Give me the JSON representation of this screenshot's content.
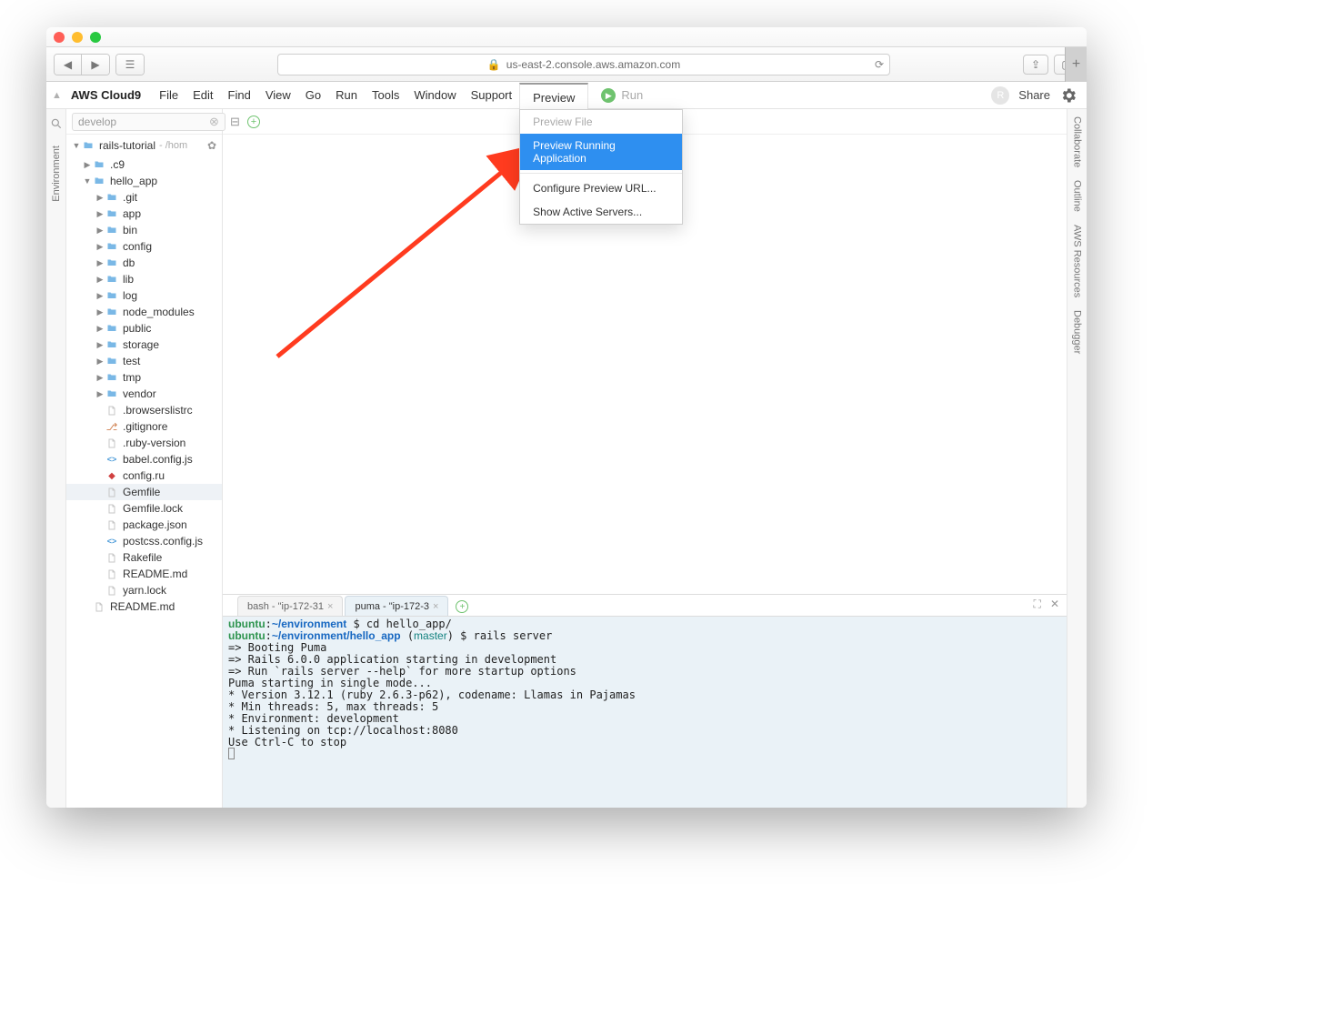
{
  "browser": {
    "url_host": "us-east-2.console.aws.amazon.com"
  },
  "menubar": {
    "brand": "AWS Cloud9",
    "items": [
      "File",
      "Edit",
      "Find",
      "View",
      "Go",
      "Run",
      "Tools",
      "Window",
      "Support"
    ],
    "preview_tab": "Preview",
    "run_tab": "Run",
    "share": "Share",
    "avatar_initial": "R"
  },
  "dropdown": {
    "items": [
      {
        "label": "Preview File",
        "disabled": true
      },
      {
        "label": "Preview Running Application",
        "highlight": true
      },
      {
        "label": "Configure Preview URL..."
      },
      {
        "label": "Show Active Servers..."
      }
    ]
  },
  "left_rail": {
    "label": "Environment"
  },
  "right_rail": {
    "labels": [
      "Collaborate",
      "Outline",
      "AWS Resources",
      "Debugger"
    ]
  },
  "sidebar": {
    "search_value": "develop",
    "root": {
      "name": "rails-tutorial",
      "path": "- /hom"
    },
    "tree": [
      {
        "d": 1,
        "t": "folder",
        "n": ".c9",
        "tw": "▶"
      },
      {
        "d": 1,
        "t": "folder",
        "n": "hello_app",
        "tw": "▼"
      },
      {
        "d": 2,
        "t": "folder",
        "n": ".git",
        "tw": "▶"
      },
      {
        "d": 2,
        "t": "folder",
        "n": "app",
        "tw": "▶"
      },
      {
        "d": 2,
        "t": "folder",
        "n": "bin",
        "tw": "▶"
      },
      {
        "d": 2,
        "t": "folder",
        "n": "config",
        "tw": "▶"
      },
      {
        "d": 2,
        "t": "folder",
        "n": "db",
        "tw": "▶"
      },
      {
        "d": 2,
        "t": "folder",
        "n": "lib",
        "tw": "▶"
      },
      {
        "d": 2,
        "t": "folder",
        "n": "log",
        "tw": "▶"
      },
      {
        "d": 2,
        "t": "folder",
        "n": "node_modules",
        "tw": "▶"
      },
      {
        "d": 2,
        "t": "folder",
        "n": "public",
        "tw": "▶"
      },
      {
        "d": 2,
        "t": "folder",
        "n": "storage",
        "tw": "▶"
      },
      {
        "d": 2,
        "t": "folder",
        "n": "test",
        "tw": "▶"
      },
      {
        "d": 2,
        "t": "folder",
        "n": "tmp",
        "tw": "▶"
      },
      {
        "d": 2,
        "t": "folder",
        "n": "vendor",
        "tw": "▶"
      },
      {
        "d": 2,
        "t": "file",
        "n": ".browserslistrc"
      },
      {
        "d": 2,
        "t": "git",
        "n": ".gitignore"
      },
      {
        "d": 2,
        "t": "file",
        "n": ".ruby-version"
      },
      {
        "d": 2,
        "t": "js",
        "n": "babel.config.js"
      },
      {
        "d": 2,
        "t": "ruby",
        "n": "config.ru"
      },
      {
        "d": 2,
        "t": "file",
        "n": "Gemfile",
        "sel": true
      },
      {
        "d": 2,
        "t": "file",
        "n": "Gemfile.lock"
      },
      {
        "d": 2,
        "t": "file",
        "n": "package.json"
      },
      {
        "d": 2,
        "t": "js",
        "n": "postcss.config.js"
      },
      {
        "d": 2,
        "t": "file",
        "n": "Rakefile"
      },
      {
        "d": 2,
        "t": "file",
        "n": "README.md"
      },
      {
        "d": 2,
        "t": "file",
        "n": "yarn.lock"
      },
      {
        "d": 1,
        "t": "file",
        "n": "README.md"
      }
    ]
  },
  "terminal": {
    "tabs": [
      {
        "label": "bash - \"ip-172-31",
        "active": false
      },
      {
        "label": "puma - \"ip-172-3",
        "active": true
      }
    ],
    "lines": [
      {
        "seg": [
          {
            "c": "g",
            "t": "ubuntu"
          },
          {
            "t": ":"
          },
          {
            "c": "b",
            "t": "~/environment"
          },
          {
            "t": " $ cd hello_app/"
          }
        ]
      },
      {
        "seg": [
          {
            "c": "g",
            "t": "ubuntu"
          },
          {
            "t": ":"
          },
          {
            "c": "b",
            "t": "~/environment/hello_app"
          },
          {
            "t": " ("
          },
          {
            "c": "c",
            "t": "master"
          },
          {
            "t": ") $ rails server"
          }
        ]
      },
      {
        "seg": [
          {
            "t": "=> Booting Puma"
          }
        ]
      },
      {
        "seg": [
          {
            "t": "=> Rails 6.0.0 application starting in development"
          }
        ]
      },
      {
        "seg": [
          {
            "t": "=> Run `rails server --help` for more startup options"
          }
        ]
      },
      {
        "seg": [
          {
            "t": "Puma starting in single mode..."
          }
        ]
      },
      {
        "seg": [
          {
            "t": "* Version 3.12.1 (ruby 2.6.3-p62), codename: Llamas in Pajamas"
          }
        ]
      },
      {
        "seg": [
          {
            "t": "* Min threads: 5, max threads: 5"
          }
        ]
      },
      {
        "seg": [
          {
            "t": "* Environment: development"
          }
        ]
      },
      {
        "seg": [
          {
            "t": "* Listening on tcp://localhost:8080"
          }
        ]
      },
      {
        "seg": [
          {
            "t": "Use Ctrl-C to stop"
          }
        ]
      }
    ]
  }
}
